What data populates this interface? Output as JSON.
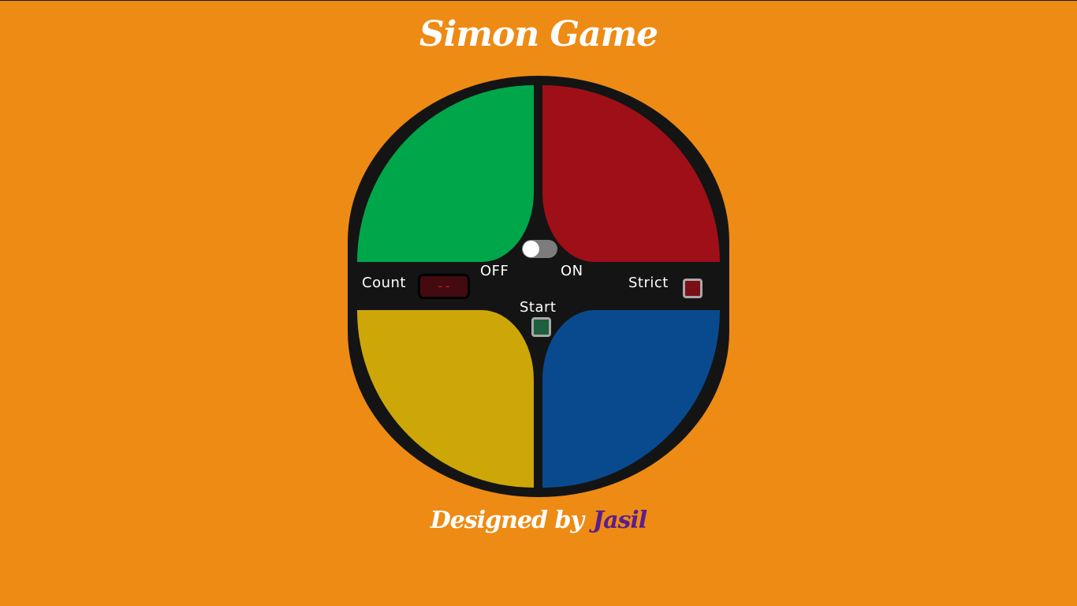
{
  "title": "Simon Game",
  "controls": {
    "count_label": "Count",
    "count_display": "--",
    "off_label": "OFF",
    "on_label": "ON",
    "strict_label": "Strict",
    "start_label": "Start",
    "power_on": false
  },
  "pads": [
    {
      "name": "green",
      "color": "#00a74a"
    },
    {
      "name": "red",
      "color": "#9f0f17"
    },
    {
      "name": "yellow",
      "color": "#cca707"
    },
    {
      "name": "blue",
      "color": "#094a8f"
    }
  ],
  "footer": {
    "designed_by": "Designed by",
    "author": "Jasil"
  },
  "colors": {
    "background": "#ee8b14",
    "board": "#141414",
    "author": "#5b1f8c"
  }
}
